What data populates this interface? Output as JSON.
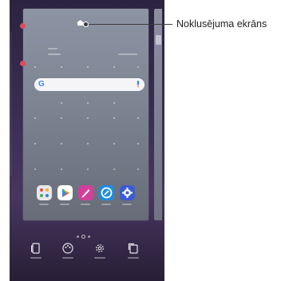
{
  "callout": {
    "label": "Noklusējuma ekrāns"
  },
  "home_preview": {
    "search": {
      "google_letter": "G"
    },
    "dock_apps": [
      {
        "name": "apps-folder-icon",
        "color": "#e8e8ea"
      },
      {
        "name": "play-store-icon",
        "color": "#ffffff"
      },
      {
        "name": "pen-app-icon",
        "color": "#d23e9a"
      },
      {
        "name": "compass-app-icon",
        "color": "#1e8de0"
      },
      {
        "name": "settings-app-icon",
        "color": "#3b5bd6"
      }
    ]
  },
  "toolbar": {
    "items": [
      {
        "icon": "wallpaper-icon"
      },
      {
        "icon": "themes-icon"
      },
      {
        "icon": "settings-gear-icon"
      },
      {
        "icon": "screen-rotate-icon"
      }
    ]
  },
  "colors": {
    "remove_badge": "#e04b5a",
    "accent_blue": "#4285f4"
  }
}
